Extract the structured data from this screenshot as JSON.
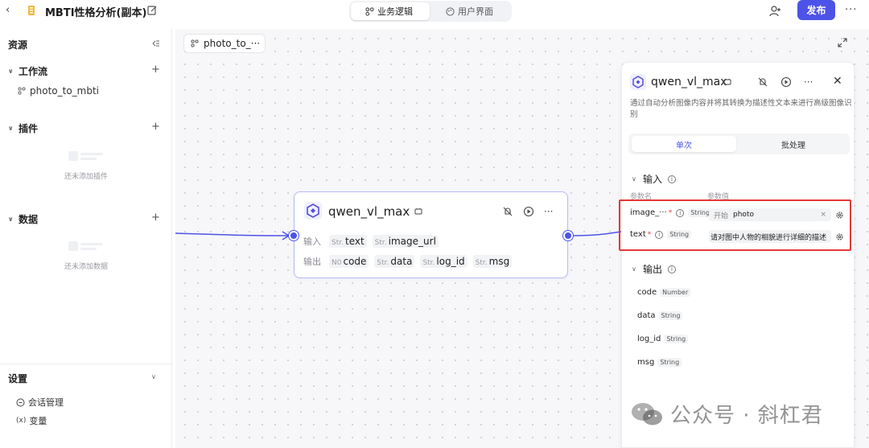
{
  "topbar": {
    "title": "MBTI性格分析(副本)",
    "tabs": [
      {
        "label": "业务逻辑",
        "active": true
      },
      {
        "label": "用户界面",
        "active": false
      }
    ],
    "publish_label": "发布",
    "more": "···"
  },
  "sidebar": {
    "title": "资源",
    "workflow_label": "工作流",
    "workflow_item": "photo_to_mbti",
    "plugins_label": "插件",
    "plugins_empty": "还未添加插件",
    "data_label": "数据",
    "data_empty": "还未添加数据",
    "settings_label": "设置",
    "settings_items": [
      "会话管理",
      "变量"
    ]
  },
  "canvas": {
    "tab_label": "photo_to_···"
  },
  "node": {
    "title": "qwen_vl_max",
    "input_label": "输入",
    "inputs": [
      {
        "type": "Str.",
        "name": "text"
      },
      {
        "type": "Str.",
        "name": "image_url"
      }
    ],
    "output_label": "输出",
    "outputs": [
      {
        "type": "N0",
        "name": "code"
      },
      {
        "type": "Str.",
        "name": "data"
      },
      {
        "type": "Str.",
        "name": "log_id"
      },
      {
        "type": "Str.",
        "name": "msg"
      }
    ],
    "more": "···"
  },
  "panel": {
    "title": "qwen_vl_max",
    "description": "通过自动分析图像内容并将其转换为描述性文本来进行高级图像识别",
    "tabs": [
      {
        "label": "单次",
        "active": true
      },
      {
        "label": "批处理",
        "active": false
      }
    ],
    "input_section": "输入",
    "col_param": "参数名",
    "col_value": "参数值",
    "inputs": [
      {
        "name": "image_···",
        "required": "*",
        "type": "String",
        "source": "开始",
        "value": "photo",
        "clear": "×"
      },
      {
        "name": "text",
        "required": "*",
        "type": "String",
        "value": "请对图中人物的相貌进行详细的描述"
      }
    ],
    "output_section": "输出",
    "outputs": [
      {
        "name": "code",
        "type": "Number"
      },
      {
        "name": "data",
        "type": "String"
      },
      {
        "name": "log_id",
        "type": "String"
      },
      {
        "name": "msg",
        "type": "String"
      }
    ],
    "close": "✕",
    "more": "···"
  },
  "watermark": {
    "text": "公众号 · 斜杠君"
  },
  "colors": {
    "accent": "#4d53e8",
    "highlight": "#e53935"
  }
}
